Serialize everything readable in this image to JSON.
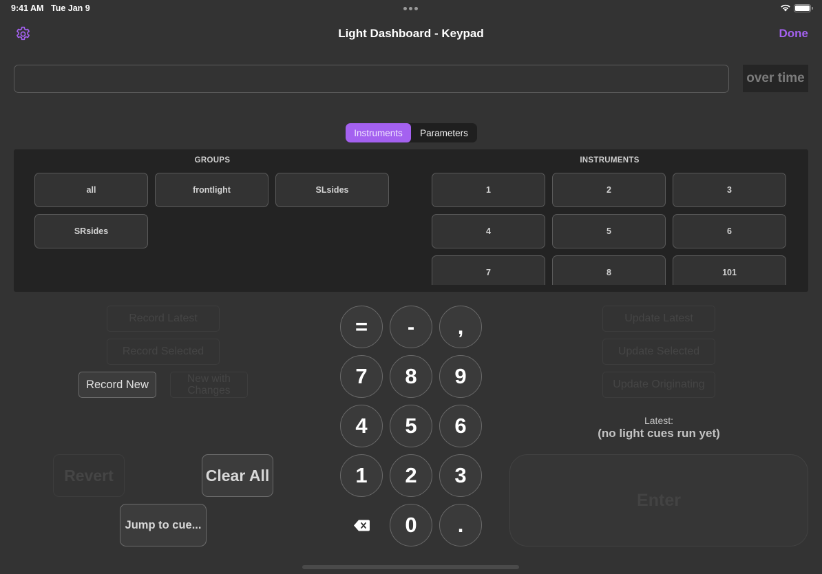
{
  "status_bar": {
    "time": "9:41 AM",
    "date": "Tue Jan 9",
    "wifi_icon": "wifi-icon",
    "battery_icon": "battery-full-icon",
    "multitask_icon": "ellipsis-icon"
  },
  "nav": {
    "title": "Light Dashboard - Keypad",
    "settings_icon": "gear-icon",
    "done_label": "Done"
  },
  "command": {
    "value": "",
    "placeholder": "",
    "over_time_label": "over time"
  },
  "tabs": {
    "items": [
      {
        "label": "Instruments",
        "selected": true
      },
      {
        "label": "Parameters",
        "selected": false
      }
    ]
  },
  "groups": {
    "header": "GROUPS",
    "items": [
      "all",
      "frontlight",
      "SLsides",
      "SRsides"
    ]
  },
  "instruments": {
    "header": "INSTRUMENTS",
    "items": [
      "1",
      "2",
      "3",
      "4",
      "5",
      "6",
      "7",
      "8",
      "101"
    ]
  },
  "record": {
    "record_latest": "Record Latest",
    "record_selected": "Record Selected",
    "record_new": "Record New",
    "new_with_changes": "New with Changes"
  },
  "update": {
    "update_latest": "Update Latest",
    "update_selected": "Update Selected",
    "update_originating": "Update Originating"
  },
  "actions": {
    "revert": "Revert",
    "clear_all": "Clear All",
    "jump_to_cue": "Jump to cue..."
  },
  "keypad": {
    "keys": [
      "=",
      "-",
      ",",
      "7",
      "8",
      "9",
      "4",
      "5",
      "6",
      "1",
      "2",
      "3",
      "0",
      "."
    ],
    "backspace_icon": "backspace-icon"
  },
  "latest": {
    "label": "Latest:",
    "value": "(no light cues run yet)"
  },
  "enter_label": "Enter",
  "colors": {
    "accent": "#a461f0",
    "background": "#333333",
    "panel": "#232323"
  }
}
